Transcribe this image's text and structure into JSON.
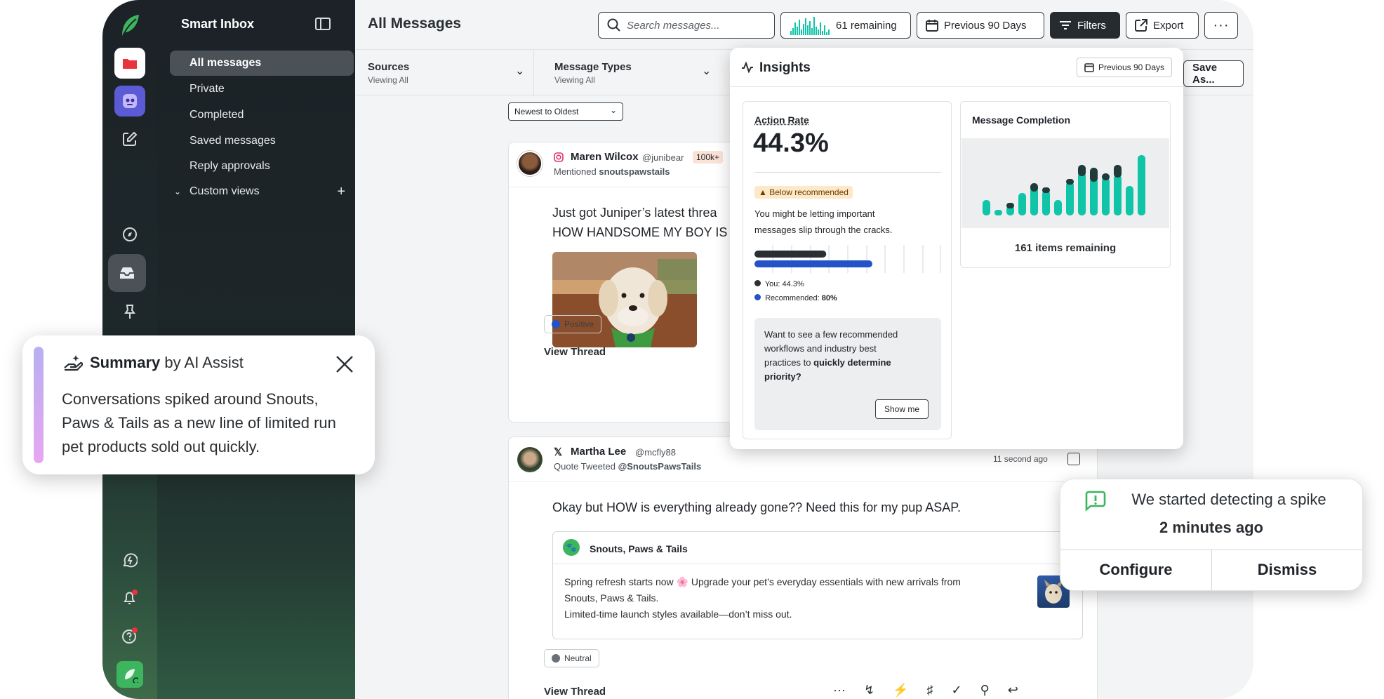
{
  "sidebar": {
    "title": "Smart Inbox",
    "items": [
      {
        "label": "All messages"
      },
      {
        "label": "Private"
      },
      {
        "label": "Completed"
      },
      {
        "label": "Saved messages"
      },
      {
        "label": "Reply approvals"
      },
      {
        "label": "Custom views"
      }
    ]
  },
  "header": {
    "title": "All Messages",
    "search_placeholder": "Search messages...",
    "remaining": "61 remaining",
    "date_range": "Previous 90 Days",
    "filters_label": "Filters",
    "export_label": "Export"
  },
  "filters": {
    "sources_label": "Sources",
    "sources_value": "Viewing All",
    "types_label": "Message Types",
    "types_value": "Viewing All",
    "save_as": "Save As...",
    "sort": "Newest to Oldest"
  },
  "messages": [
    {
      "author": "Maren Wilcox",
      "handle": "@junibear",
      "badge": "100k+",
      "context_prefix": "Mentioned",
      "context_target": "snoutspawstails",
      "text_line1": "Just got Juniper’s latest threa",
      "text_line2": "HOW HANDSOME MY BOY IS",
      "sentiment": "Positive",
      "view_thread": "View Thread"
    },
    {
      "author": "Martha Lee",
      "handle": "@mcfly88",
      "context_prefix": "Quote Tweeted",
      "context_target": "@SnoutsPawsTails",
      "time": "11 second ago",
      "text": "Okay but HOW is everything already gone?? Need this for my pup ASAP.",
      "quote_author": "Snouts, Paws & Tails",
      "quote_line1": "Spring refresh starts now 🌸 Upgrade your pet’s everyday essentials with new arrivals from",
      "quote_line2": "Snouts, Paws & Tails.",
      "quote_line3": "Limited-time launch styles available—don’t miss out.",
      "sentiment": "Neutral",
      "view_thread": "View Thread"
    }
  ],
  "insights": {
    "title": "Insights",
    "range": "Previous 90 Days",
    "action_rate_label": "Action Rate",
    "action_rate_value": "44.3%",
    "badge": "Below recommended",
    "desc_line1": "You might be letting important",
    "desc_line2": "messages slip through the cracks.",
    "you_value": 44.3,
    "recommended_value": 80,
    "you_label": "You: 44.3%",
    "rec_prefix": "Recommended: ",
    "rec_value": "80%",
    "cta_line1": "Want to see a few recommended",
    "cta_line2": "workflows and industry best",
    "cta_line3_prefix": "practices to ",
    "cta_line3_bold": "quickly determine",
    "cta_line4": "priority?",
    "show_me": "Show me",
    "completion_title": "Message Completion",
    "completion_remaining": "161 items remaining"
  },
  "summary": {
    "title": "Summary",
    "by": "by AI Assist",
    "body_line1": "Conversations spiked around Snouts,",
    "body_line2": "Paws & Tails as a new line of limited run",
    "body_line3": "pet products sold out quickly."
  },
  "spike": {
    "line1": "We started detecting a spike",
    "line2": "2 minutes ago",
    "configure": "Configure",
    "dismiss": "Dismiss"
  },
  "colors": {
    "accent_teal": "#10c4a8",
    "dark_teal": "#1f3b3a",
    "rec_blue": "#2452c7",
    "brand_green": "#3cb55e"
  }
}
